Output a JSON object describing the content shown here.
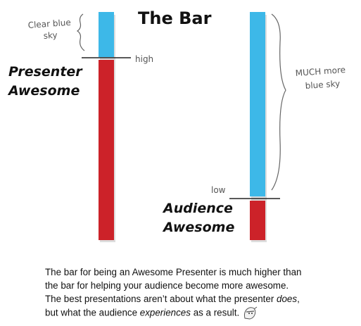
{
  "title": "The Bar",
  "left_bar": {
    "annotation_line1": "Clear blue",
    "annotation_line2": "sky",
    "marker_label": "high",
    "label_line1": "Presenter",
    "label_line2": "Awesome"
  },
  "right_bar": {
    "annotation_line1": "MUCH more",
    "annotation_line2": "blue sky",
    "marker_label": "low",
    "label_line1": "Audience",
    "label_line2": "Awesome"
  },
  "colors": {
    "sky": "#3db8e8",
    "awesome": "#cc2229",
    "shadow": "#dddddd"
  },
  "caption": {
    "line1": "The bar for being an Awesome Presenter is much higher than",
    "line2": "the bar for helping your audience become more awesome.",
    "line3_pre": "The best presentations aren’t about what the presenter ",
    "line3_em": "does",
    "line3_post": ",",
    "line4_pre": "but what the audience ",
    "line4_em": "experiences",
    "line4_post": " as a result.",
    "logo_icon": "ninja-head-icon"
  }
}
